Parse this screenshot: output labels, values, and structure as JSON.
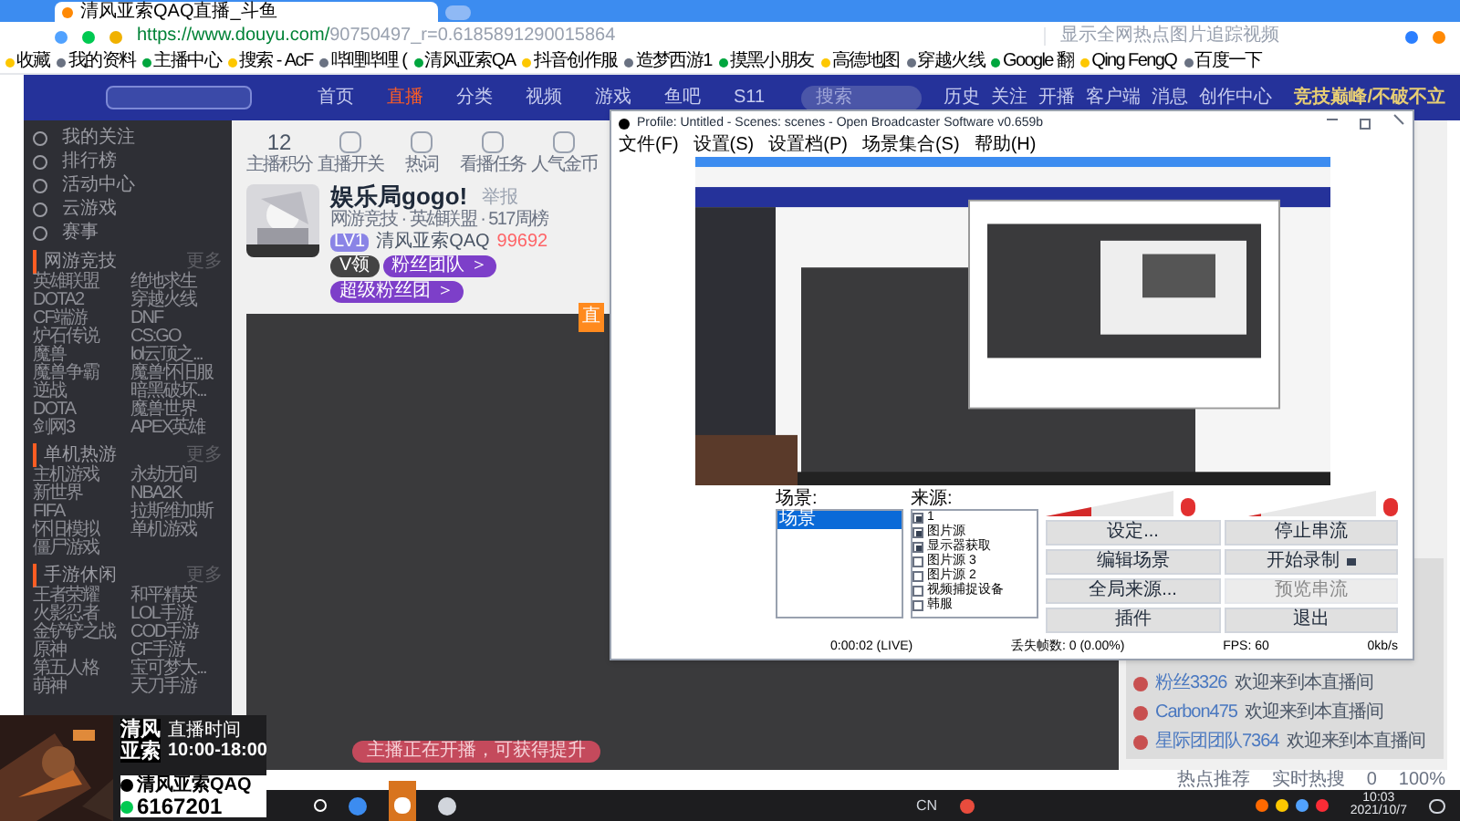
{
  "browser": {
    "tab_title": "清风亚索QAQ直播_斗鱼",
    "url_host": "https://www.douyu.com/",
    "url_path": "90750497_r=0.6185891290015864",
    "search_placeholder": "显示全网热点图片追踪视频"
  },
  "bookmarks": [
    "收藏",
    "我的资料",
    "主播中心",
    "搜索 - AcF",
    "哔哩哔哩 (",
    "清风亚索QA",
    "抖音创作服",
    "造梦西游1",
    "摸黑小朋友",
    "高德地图",
    "穿越火线",
    "Google 翻",
    "Qing FengQ",
    "百度一下"
  ],
  "site_header": {
    "nav": [
      {
        "label": "首页",
        "selected": false
      },
      {
        "label": "直播",
        "selected": true
      },
      {
        "label": "分类",
        "selected": false
      },
      {
        "label": "视频",
        "selected": false
      },
      {
        "label": "游戏",
        "selected": false
      },
      {
        "label": "鱼吧",
        "selected": false
      },
      {
        "label": "S11",
        "selected": false
      }
    ],
    "search_placeholder": "搜索",
    "actions": [
      "历史",
      "关注",
      "开播",
      "客户端",
      "消息",
      "创作中心"
    ],
    "banner": "竞技巅峰/不破不立"
  },
  "sidebar": {
    "items": [
      "我的关注",
      "排行榜",
      "活动中心",
      "云游戏",
      "赛事"
    ],
    "sections": [
      {
        "title": "网游竞技",
        "more": "更多",
        "games": [
          "英雄联盟",
          "绝地求生",
          "DOTA2",
          "穿越火线",
          "CF端游",
          "DNF",
          "炉石传说",
          "CS:GO",
          "魔兽",
          "lol云顶之...",
          "魔兽争霸",
          "魔兽怀旧服",
          "逆战",
          "暗黑破坏...",
          "DOTA",
          "魔兽世界",
          "剑网3",
          "APEX英雄"
        ]
      },
      {
        "title": "单机热游",
        "more": "更多",
        "games": [
          "主机游戏",
          "永劫无间",
          "新世界",
          "NBA2K",
          "FIFA",
          "拉斯维加斯",
          "怀旧模拟",
          "单机游戏",
          "僵尸游戏"
        ]
      },
      {
        "title": "手游休闲",
        "more": "更多",
        "games": [
          "王者荣耀",
          "和平精英",
          "火影忍者",
          "LOL手游",
          "金铲铲之战",
          "COD手游",
          "原神",
          "CF手游",
          "第五人格",
          "宝可梦大...",
          "萌神",
          "天刀手游"
        ]
      }
    ]
  },
  "room": {
    "stats": [
      {
        "value": "12",
        "label": "主播积分"
      },
      {
        "label": "直播开关"
      },
      {
        "label": "热词"
      },
      {
        "label": "看播任务"
      },
      {
        "label": "人气金币"
      }
    ],
    "title": "娱乐局gogo!",
    "report": "举报",
    "breadcrumb": "网游竞技 · 英雄联盟 · 517周榜",
    "level": "LV1",
    "streamer": "清风亚索QAQ",
    "heat": "99692",
    "tags": [
      "V领",
      "粉丝团队 ＞",
      "超级粉丝团 ＞"
    ]
  },
  "side_tab": "直",
  "player_notice": "主播正在开播，可获得提升",
  "chat": [
    {
      "user": "粉丝3326",
      "text": "欢迎来到本直播间"
    },
    {
      "user": "Carbon475",
      "text": "欢迎来到本直播间"
    },
    {
      "user": "星际团团队7364",
      "text": "欢迎来到本直播间"
    }
  ],
  "obs": {
    "title": "Profile: Untitled - Scenes: scenes - Open Broadcaster Software v0.659b",
    "menu": [
      "文件(F)",
      "设置(S)",
      "设置档(P)",
      "场景集合(S)",
      "帮助(H)"
    ],
    "scenes_label": "场景:",
    "scenes": [
      {
        "label": "场景",
        "selected": true
      }
    ],
    "sources_label": "来源:",
    "sources": [
      {
        "label": "1",
        "checked": true
      },
      {
        "label": "图片源",
        "checked": true
      },
      {
        "label": "显示器获取",
        "checked": true
      },
      {
        "label": "图片源 3",
        "checked": false
      },
      {
        "label": "图片源 2",
        "checked": false
      },
      {
        "label": "视频捕捉设备",
        "checked": false
      },
      {
        "label": "韩服",
        "checked": false
      }
    ],
    "mic": {
      "level": 0.35
    },
    "speaker": {
      "level": 0.1
    },
    "buttons": [
      {
        "label": "设定...",
        "disabled": false,
        "dropdown": false
      },
      {
        "label": "停止串流",
        "disabled": false,
        "dropdown": false
      },
      {
        "label": "编辑场景",
        "disabled": false,
        "dropdown": false
      },
      {
        "label": "开始录制",
        "disabled": false,
        "dropdown": true
      },
      {
        "label": "全局来源...",
        "disabled": false,
        "dropdown": false
      },
      {
        "label": "预览串流",
        "disabled": true,
        "dropdown": false
      },
      {
        "label": "插件",
        "disabled": false,
        "dropdown": false
      },
      {
        "label": "退出",
        "disabled": false,
        "dropdown": false
      }
    ],
    "status": [
      "0:00:02 (LIVE)",
      "丢失帧数: 0 (0.00%)",
      "FPS: 60",
      "0kb/s"
    ]
  },
  "overlay": {
    "name_lines": [
      "清风",
      "亚索"
    ],
    "schedule_label": "直播时间",
    "schedule": "10:00-18:00",
    "douyin": "清风亚索QAQ",
    "wechat": "6167201"
  },
  "status_bar": [
    "热点推荐",
    "实时热搜",
    "0",
    "100%"
  ],
  "taskbar": {
    "ime": "CN",
    "clock": "10:03",
    "date": "2021/10/7"
  }
}
